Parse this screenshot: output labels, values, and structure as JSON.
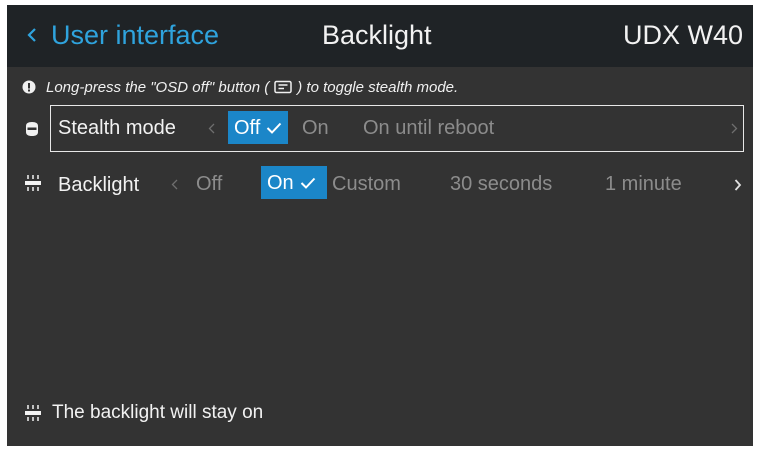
{
  "header": {
    "back_label": "User interface",
    "title": "Backlight",
    "model": "UDX W40"
  },
  "info": {
    "text_before": "Long-press the \"OSD off\" button (",
    "text_after": ") to toggle stealth mode."
  },
  "stealth": {
    "label": "Stealth mode",
    "options": [
      "Off",
      "On",
      "On until reboot"
    ],
    "selected": "Off"
  },
  "backlight": {
    "label": "Backlight",
    "options": [
      "Off",
      "On",
      "Custom",
      "30 seconds",
      "1 minute"
    ],
    "selected": "On"
  },
  "footer": {
    "text": "The backlight will stay on"
  },
  "colors": {
    "accent": "#1b86c8",
    "link": "#2fa3dd",
    "background": "#333333",
    "header": "#1f2326"
  },
  "icons": {
    "back": "chevron-left-icon",
    "info": "info-icon",
    "osd": "osd-button-icon",
    "stealth": "stealth-icon",
    "backlight": "backlight-icon",
    "check": "check-icon"
  }
}
